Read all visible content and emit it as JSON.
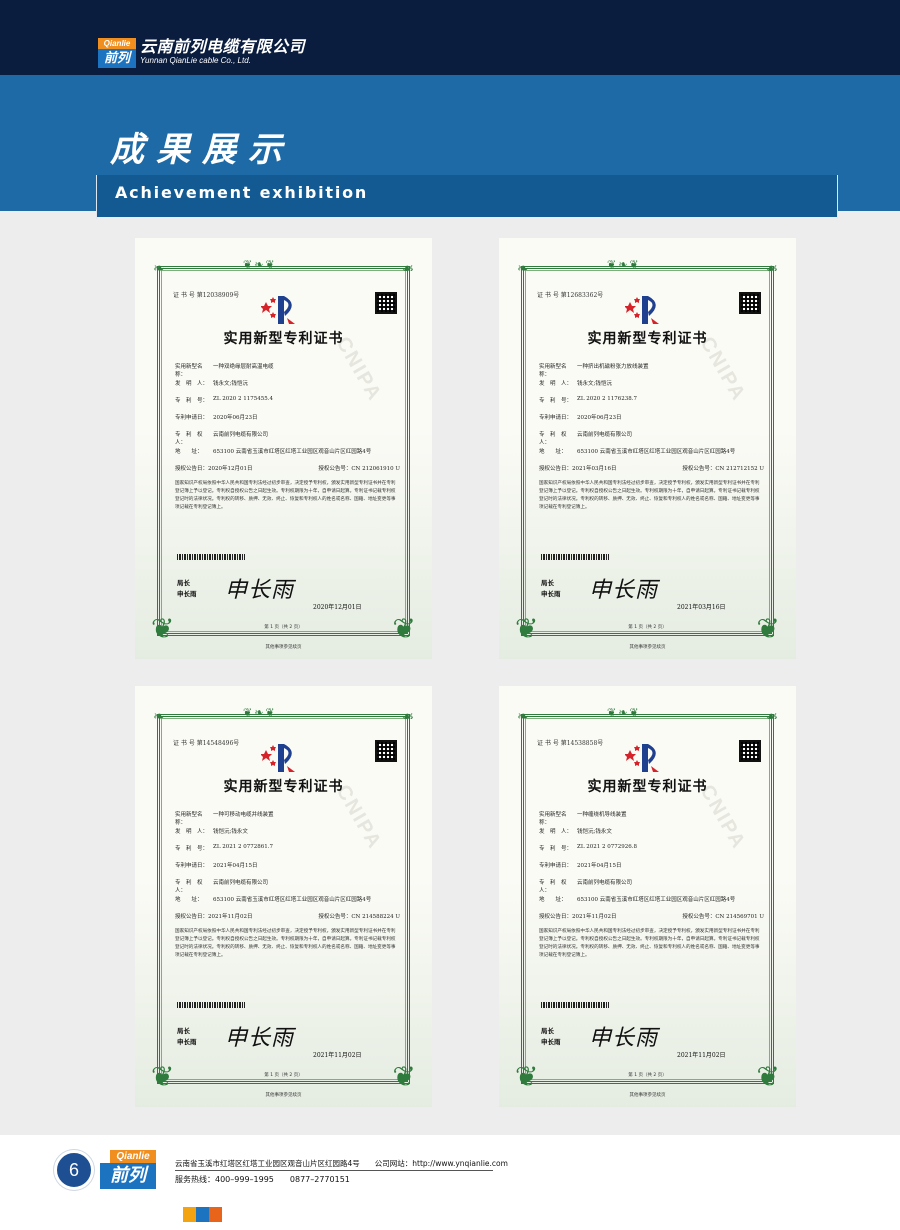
{
  "header": {
    "logo_en": "Qianlie",
    "logo_cn": "前列",
    "company_cn": "云南前列电缆有限公司",
    "company_en": "Yunnan QianLie cable Co., Ltd."
  },
  "banner": {
    "title": "成果展示",
    "subtitle": "Achievement exhibition"
  },
  "certificates": [
    {
      "certno": "证 书 号 第12038909号",
      "title": "实用新型专利证书",
      "watermark": "CNIPA",
      "f_name_lbl": "实用新型名称：",
      "f_name": "一种双绝缘层耐高温电缆",
      "f_inventor_lbl": "发　明　人：",
      "f_inventor": "钱永文;钱恺沅",
      "f_patent_lbl": "专　利　号：",
      "f_patent": "ZL 2020 2 1175455.4",
      "f_apply_lbl": "专利申请日：",
      "f_apply": "2020年06月23日",
      "f_owner_lbl": "专　利　权　人：",
      "f_owner": "云南前列电缆有限公司",
      "f_addr_lbl": "地　　址：",
      "f_addr": "653100 云南省玉溪市红塔区红塔工业园区观音山片区红园路4号",
      "f_pub_lbl": "授权公告日：",
      "f_pub": "2020年12月01日",
      "f_pubno_lbl": "授权公告号：",
      "f_pubno": "CN 212061910 U",
      "body": "国家知识产权局依照中华人民共和国专利法经过初步审查，决定授予专利权，颁发实用新型专利证书并在专利登记簿上予以登记。专利权自授权公告之日起生效。专利权期限为十年，自申请日起算。专利证书记载专利权登记时的法律状况。专利权的转移、质押、无效、终止、恢复和专利权人的姓名或名称、国籍、地址变更等事项记载在专利登记簿上。",
      "sig_title": "局长",
      "sig_name": "申长雨",
      "signature": "申长雨",
      "date": "2020年12月01日",
      "page": "第 1 页（共 2 页）",
      "foot": "其他事项参见续页"
    },
    {
      "certno": "证 书 号 第12683362号",
      "title": "实用新型专利证书",
      "watermark": "CNIPA",
      "f_name_lbl": "实用新型名称：",
      "f_name": "一种挤出机磁粉张力放线装置",
      "f_inventor_lbl": "发　明　人：",
      "f_inventor": "钱永文;钱恺沅",
      "f_patent_lbl": "专　利　号：",
      "f_patent": "ZL 2020 2 1176238.7",
      "f_apply_lbl": "专利申请日：",
      "f_apply": "2020年06月23日",
      "f_owner_lbl": "专　利　权　人：",
      "f_owner": "云南前列电缆有限公司",
      "f_addr_lbl": "地　　址：",
      "f_addr": "653100 云南省玉溪市红塔区红塔工业园区观音山片区红园路4号",
      "f_pub_lbl": "授权公告日：",
      "f_pub": "2021年03月16日",
      "f_pubno_lbl": "授权公告号：",
      "f_pubno": "CN 212712152 U",
      "body": "国家知识产权局依照中华人民共和国专利法经过初步审查，决定授予专利权，颁发实用新型专利证书并在专利登记簿上予以登记。专利权自授权公告之日起生效。专利权期限为十年，自申请日起算。专利证书记载专利权登记时的法律状况。专利权的转移、质押、无效、终止、恢复和专利权人的姓名或名称、国籍、地址变更等事项记载在专利登记簿上。",
      "sig_title": "局长",
      "sig_name": "申长雨",
      "signature": "申长雨",
      "date": "2021年03月16日",
      "page": "第 1 页（共 2 页）",
      "foot": "其他事项参见续页"
    },
    {
      "certno": "证 书 号 第14548496号",
      "title": "实用新型专利证书",
      "watermark": "CNIPA",
      "f_name_lbl": "实用新型名称：",
      "f_name": "一种可移动电缆并线装置",
      "f_inventor_lbl": "发　明　人：",
      "f_inventor": "钱恺沅;钱永文",
      "f_patent_lbl": "专　利　号：",
      "f_patent": "ZL 2021 2 0772861.7",
      "f_apply_lbl": "专利申请日：",
      "f_apply": "2021年04月15日",
      "f_owner_lbl": "专　利　权　人：",
      "f_owner": "云南前列电缆有限公司",
      "f_addr_lbl": "地　　址：",
      "f_addr": "653100 云南省玉溪市红塔区红塔工业园区观音山片区红园路4号",
      "f_pub_lbl": "授权公告日：",
      "f_pub": "2021年11月02日",
      "f_pubno_lbl": "授权公告号：",
      "f_pubno": "CN 214588224 U",
      "body": "国家知识产权局依照中华人民共和国专利法经过初步审查，决定授予专利权，颁发实用新型专利证书并在专利登记簿上予以登记。专利权自授权公告之日起生效。专利权期限为十年，自申请日起算。专利证书记载专利权登记时的法律状况。专利权的转移、质押、无效、终止、恢复和专利权人的姓名或名称、国籍、地址变更等事项记载在专利登记簿上。",
      "sig_title": "局长",
      "sig_name": "申长雨",
      "signature": "申长雨",
      "date": "2021年11月02日",
      "page": "第 1 页（共 2 页）",
      "foot": "其他事项参见续页"
    },
    {
      "certno": "证 书 号 第14538858号",
      "title": "实用新型专利证书",
      "watermark": "CNIPA",
      "f_name_lbl": "实用新型名称：",
      "f_name": "一种缠绕机导线装置",
      "f_inventor_lbl": "发　明　人：",
      "f_inventor": "钱恺沅;钱永文",
      "f_patent_lbl": "专　利　号：",
      "f_patent": "ZL 2021 2 0772926.8",
      "f_apply_lbl": "专利申请日：",
      "f_apply": "2021年04月15日",
      "f_owner_lbl": "专　利　权　人：",
      "f_owner": "云南前列电缆有限公司",
      "f_addr_lbl": "地　　址：",
      "f_addr": "653100 云南省玉溪市红塔区红塔工业园区观音山片区红园路4号",
      "f_pub_lbl": "授权公告日：",
      "f_pub": "2021年11月02日",
      "f_pubno_lbl": "授权公告号：",
      "f_pubno": "CN 214569701 U",
      "body": "国家知识产权局依照中华人民共和国专利法经过初步审查，决定授予专利权，颁发实用新型专利证书并在专利登记簿上予以登记。专利权自授权公告之日起生效。专利权期限为十年，自申请日起算。专利证书记载专利权登记时的法律状况。专利权的转移、质押、无效、终止、恢复和专利权人的姓名或名称、国籍、地址变更等事项记载在专利登记簿上。",
      "sig_title": "局长",
      "sig_name": "申长雨",
      "signature": "申长雨",
      "date": "2021年11月02日",
      "page": "第 1 页（共 2 页）",
      "foot": "其他事项参见续页"
    }
  ],
  "footer": {
    "page_number": "6",
    "logo_en": "Qianlie",
    "logo_cn": "前列",
    "address_website": "云南省玉溪市红塔区红塔工业园区观音山片区红园路4号　　公司网站：http://www.ynqianlie.com",
    "hotline": "服务热线：400–999–1995　　0877–2770151"
  },
  "colors": {
    "top_bar": "#0b1d3f",
    "banner": "#1d6aa6",
    "cert_frame": "#2f7b3d",
    "accent_orange": "#f08f1f",
    "accent_blue": "#1c74c1"
  }
}
